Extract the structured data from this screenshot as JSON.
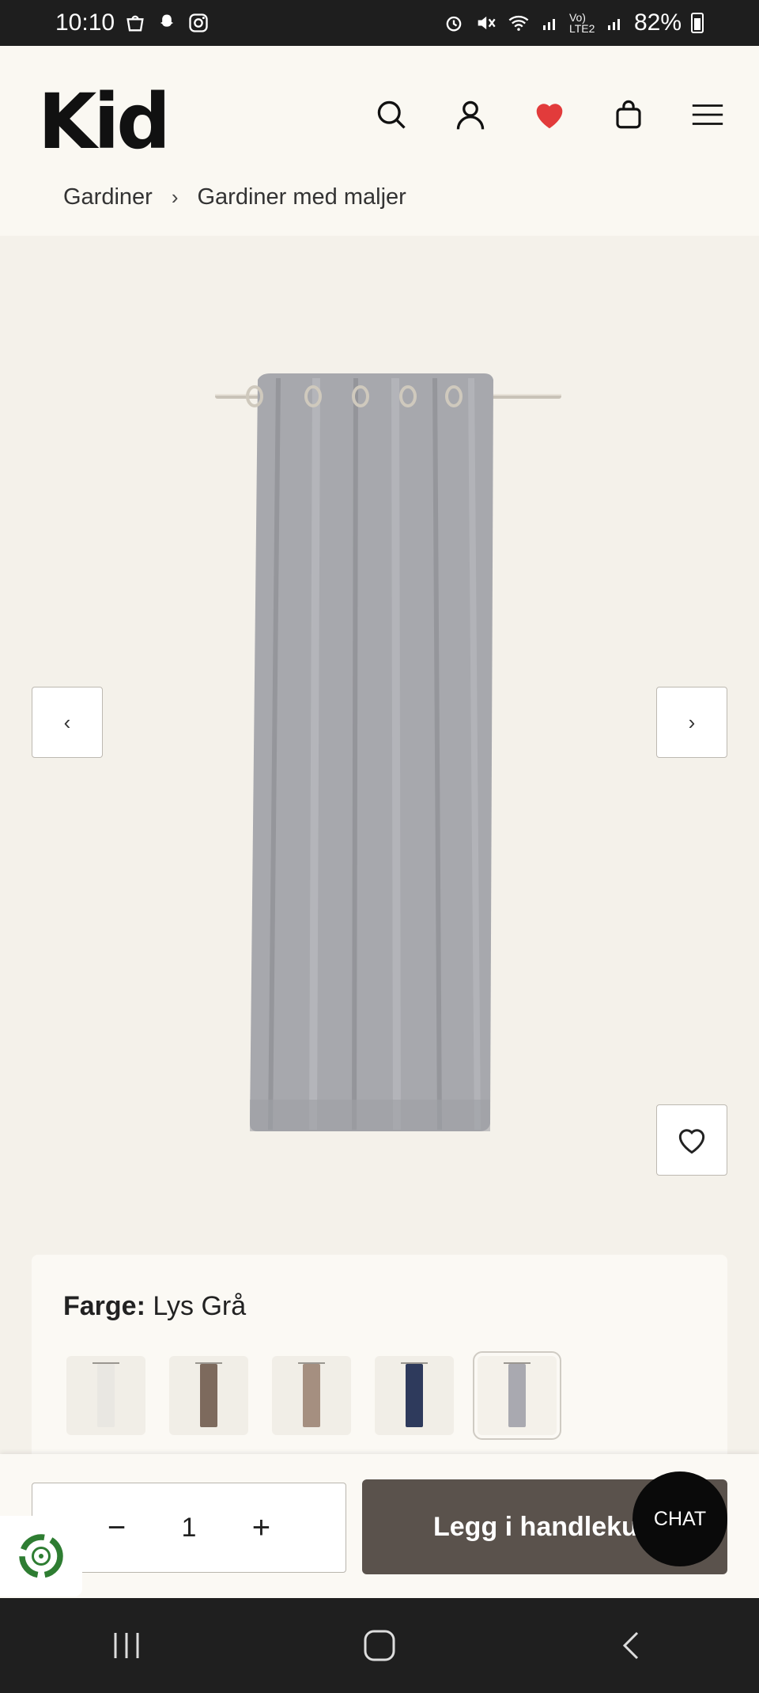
{
  "status_bar": {
    "time": "10:10",
    "battery": "82%",
    "network_label": "Vo) LTE2",
    "left_icons": [
      "shopping-bag-icon",
      "snapchat-icon",
      "instagram-icon"
    ],
    "right_icons": [
      "alarm-icon",
      "mute-icon",
      "wifi-icon",
      "signal-icon",
      "signal-icon"
    ]
  },
  "header": {
    "logo": "Kid",
    "icons": [
      "search-icon",
      "user-icon",
      "heart-icon",
      "cart-icon",
      "menu-icon"
    ],
    "wishlist_color": "#e23b3b"
  },
  "breadcrumb": {
    "items": [
      "Gardiner",
      "Gardiner med maljer"
    ]
  },
  "gallery": {
    "prev_label": "‹",
    "next_label": "›",
    "image_subject": "light grey curtain with eyelets on rod"
  },
  "color_selector": {
    "label": "Farge:",
    "value": "Lys Grå",
    "swatches": [
      {
        "color": "#e9e7e2",
        "selected": false
      },
      {
        "color": "#7d6a5d",
        "selected": false
      },
      {
        "color": "#a58f80",
        "selected": false
      },
      {
        "color": "#2e3a5c",
        "selected": false
      },
      {
        "color": "#a9a9b0",
        "selected": true
      }
    ]
  },
  "cart_bar": {
    "minus": "−",
    "quantity": "1",
    "plus": "+",
    "add_to_cart": "Legg i handlekurv"
  },
  "chat": {
    "label": "CHAT"
  },
  "colors": {
    "accent_button": "#5a524c",
    "background": "#f4f1ea"
  }
}
